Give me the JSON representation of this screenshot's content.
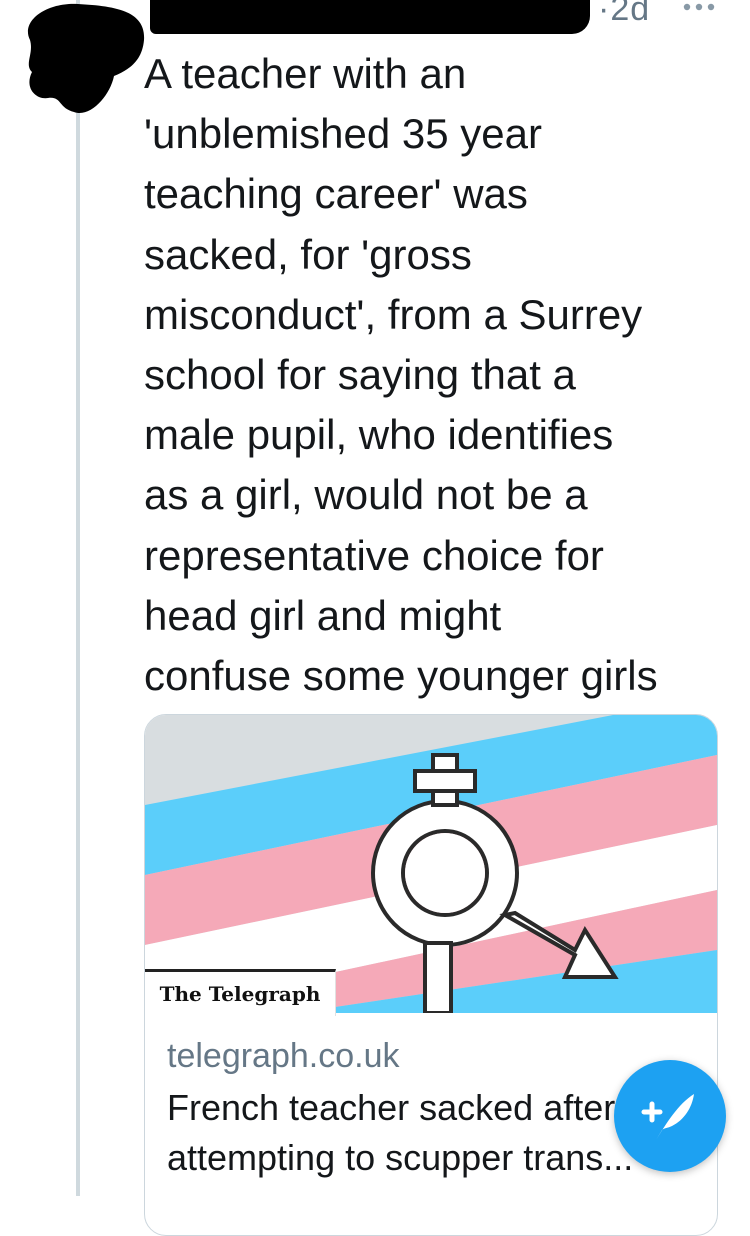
{
  "tweet": {
    "timestamp": "·2d",
    "text": "A teacher with an\n'unblemished 35 year\nteaching career' was\nsacked, for 'gross\nmisconduct', from a Surrey\nschool for saying that a\nmale pupil, who identifies\nas a girl, would not be a\nrepresentative choice for\nhead girl and might\nconfuse some younger girls"
  },
  "card": {
    "source_label": "The Telegraph",
    "domain": "telegraph.co.uk",
    "title": "French teacher sacked after attempting to scupper trans..."
  },
  "icons": {
    "more": "more-horizontal-icon",
    "compose": "compose-tweet-icon"
  },
  "colors": {
    "accent": "#1da1f2",
    "secondary_text": "#657786",
    "border": "#ccd6dd",
    "flag_blue": "#5bcefa",
    "flag_pink": "#f5a9b8"
  }
}
